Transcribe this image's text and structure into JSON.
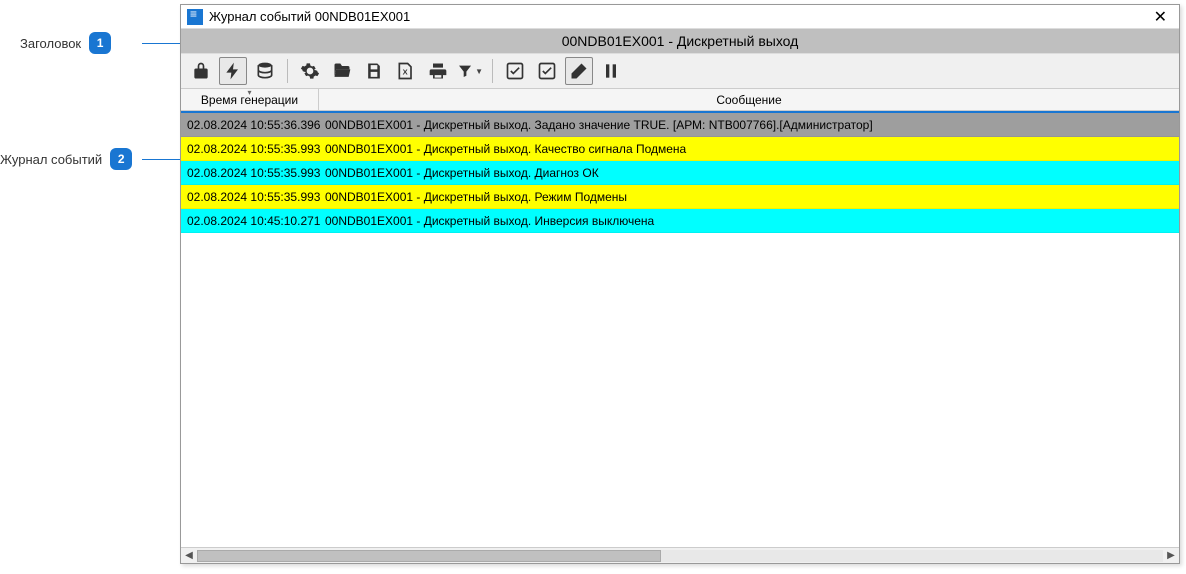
{
  "callouts": {
    "c1": {
      "label": "Заголовок",
      "num": "1"
    },
    "c2": {
      "label": "Журнал событий",
      "num": "2"
    }
  },
  "window": {
    "title": "Журнал событий 00NDB01EX001"
  },
  "header": {
    "title": "00NDB01EX001 - Дискретный выход"
  },
  "columns": {
    "time": "Время генерации",
    "message": "Сообщение"
  },
  "rows": [
    {
      "style": "gray",
      "time": "02.08.2024 10:55:36.396",
      "msg": "00NDB01EX001 - Дискретный выход. Задано значение TRUE. [АРМ: NTB007766].[Администратор]"
    },
    {
      "style": "yellow",
      "time": "02.08.2024 10:55:35.993",
      "msg": "00NDB01EX001 - Дискретный выход. Качество сигнала Подмена"
    },
    {
      "style": "cyan",
      "time": "02.08.2024 10:55:35.993",
      "msg": "00NDB01EX001 - Дискретный выход. Диагноз ОК"
    },
    {
      "style": "yellow",
      "time": "02.08.2024 10:55:35.993",
      "msg": "00NDB01EX001 - Дискретный выход. Режим Подмены"
    },
    {
      "style": "cyan",
      "time": "02.08.2024 10:45:10.271",
      "msg": "00NDB01EX001 - Дискретный выход. Инверсия выключена"
    }
  ]
}
